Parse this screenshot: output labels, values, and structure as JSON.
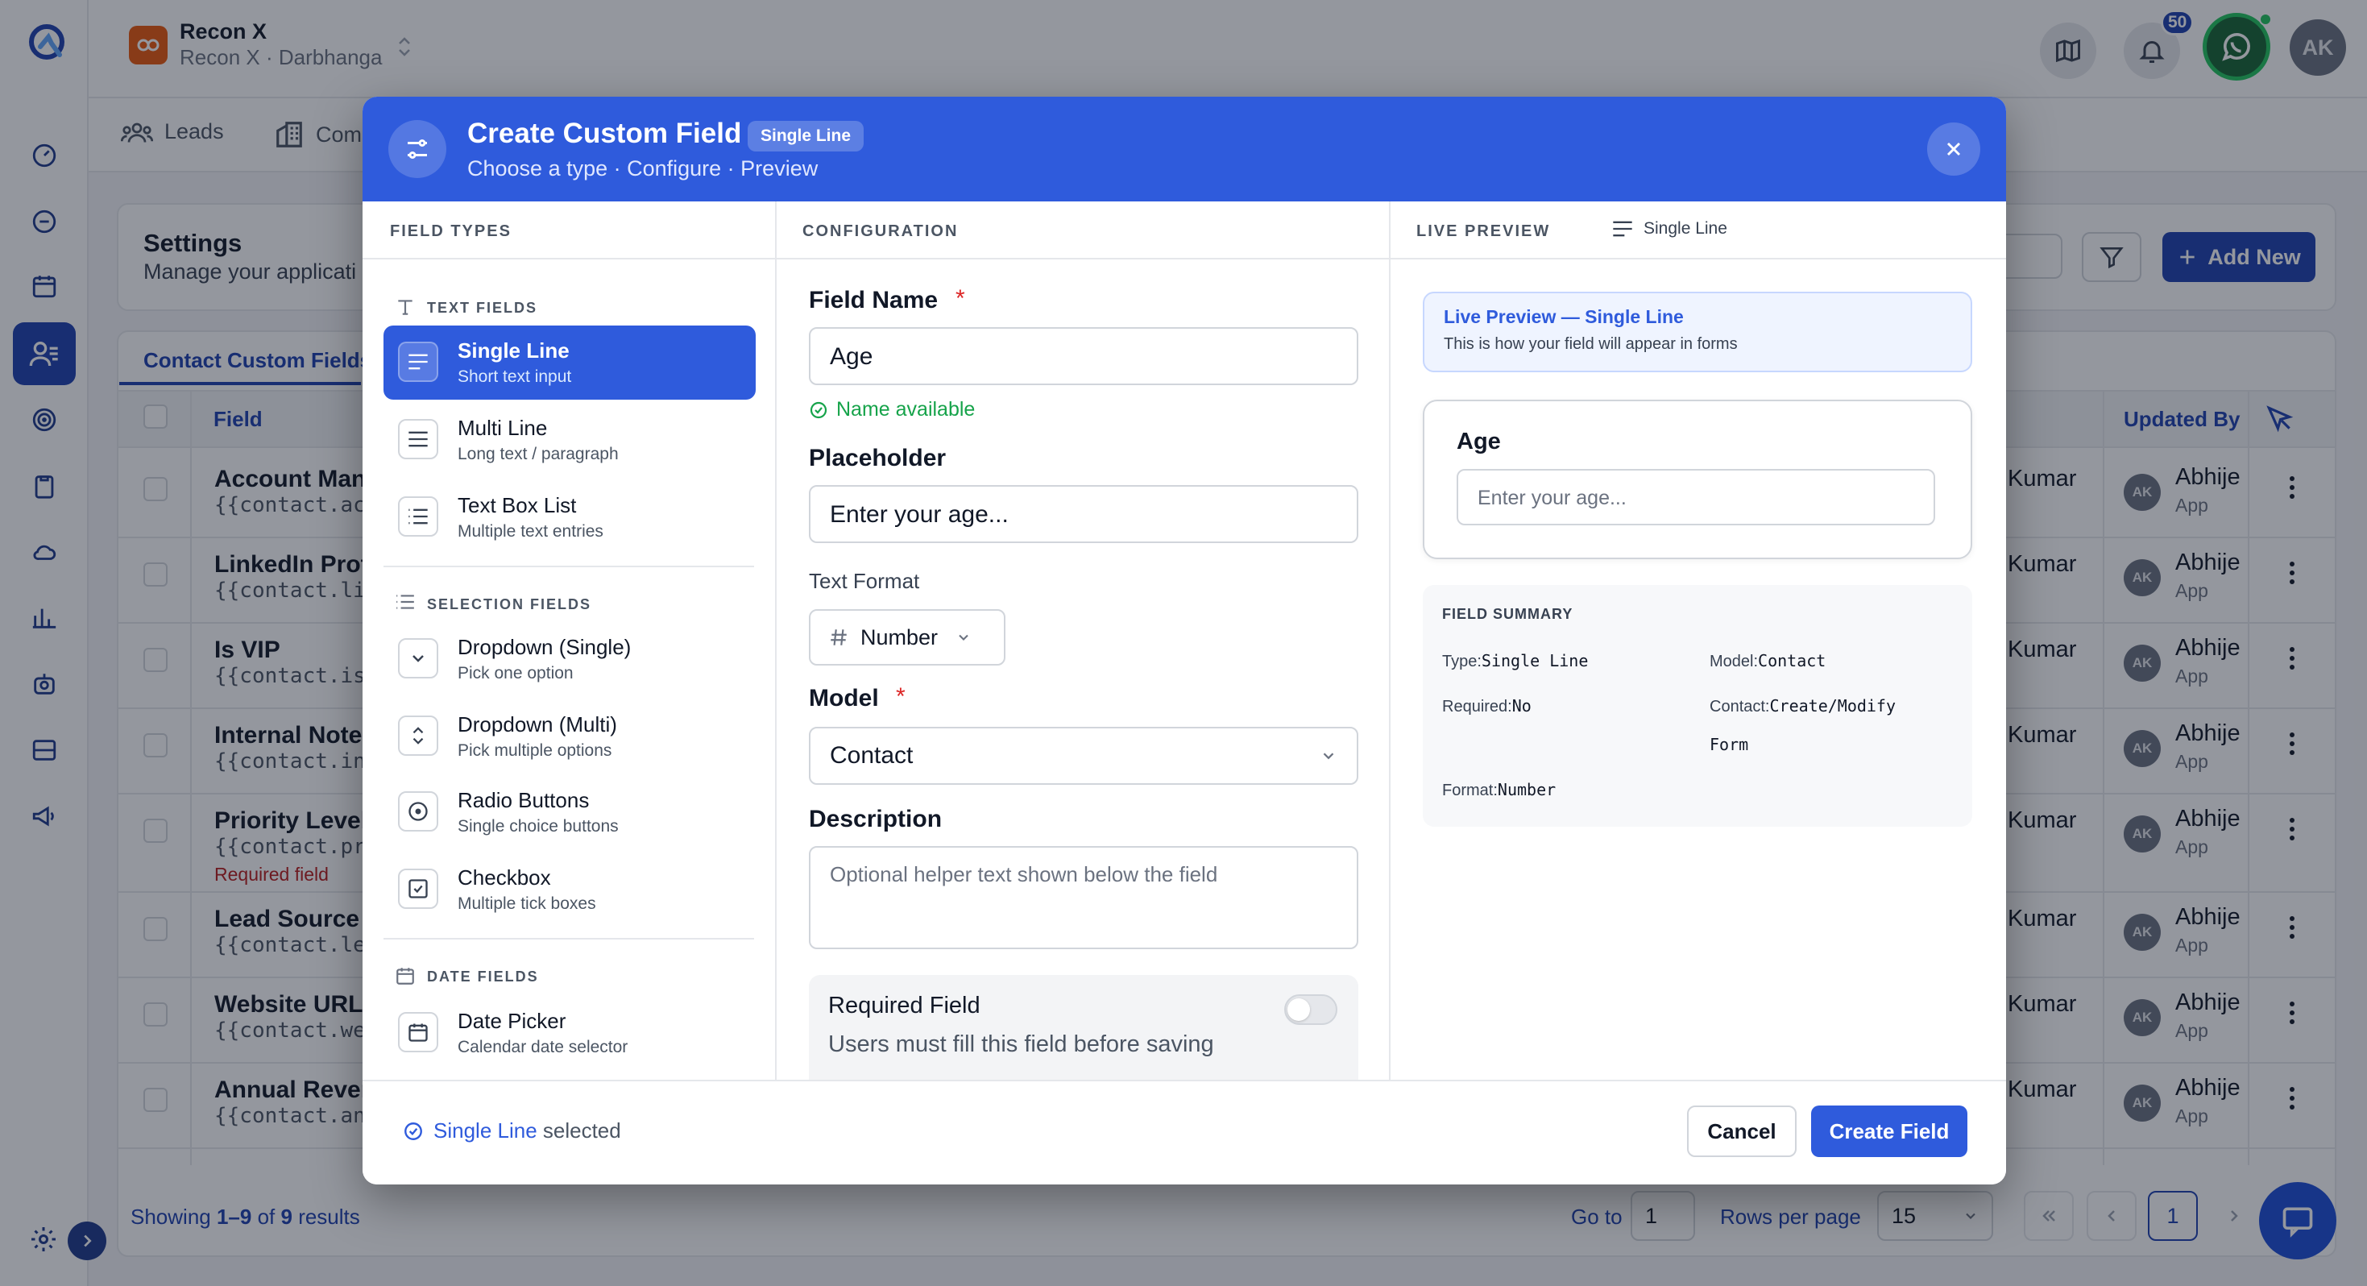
{
  "app": {
    "org_name": "Recon X",
    "org_subtitle": "Recon X · Darbhanga",
    "notification_count": "50",
    "user_initials": "AK"
  },
  "tabs": [
    {
      "label": "Leads"
    },
    {
      "label": "Com"
    }
  ],
  "settings": {
    "title": "Settings",
    "subtitle": "Manage your applicati",
    "add_new_label": "Add New",
    "active_tab": "Contact Custom Fields"
  },
  "table": {
    "headers": {
      "field": "Field",
      "updated_by": "Updated By"
    },
    "rows": [
      {
        "name": "Account Man",
        "key": "{{contact.acc",
        "required": "",
        "kumar": "Kumar",
        "initials": "AK",
        "updated_by": "Abhije",
        "updated_via": "App"
      },
      {
        "name": "LinkedIn Profi",
        "key": "{{contact.lin",
        "required": "",
        "kumar": "Kumar",
        "initials": "AK",
        "updated_by": "Abhije",
        "updated_via": "App"
      },
      {
        "name": "Is VIP",
        "key": "{{contact.is_",
        "required": "",
        "kumar": "Kumar",
        "initials": "AK",
        "updated_by": "Abhije",
        "updated_via": "App"
      },
      {
        "name": "Internal Note",
        "key": "{{contact.int",
        "required": "",
        "kumar": "Kumar",
        "initials": "AK",
        "updated_by": "Abhije",
        "updated_via": "App"
      },
      {
        "name": "Priority Level",
        "key": "{{contact.pri",
        "required": "Required field",
        "kumar": "Kumar",
        "initials": "AK",
        "updated_by": "Abhije",
        "updated_via": "App"
      },
      {
        "name": "Lead Source",
        "key": "{{contact.lea",
        "required": "",
        "kumar": "Kumar",
        "initials": "AK",
        "updated_by": "Abhije",
        "updated_via": "App"
      },
      {
        "name": "Website URL",
        "key": "{{contact.web",
        "required": "",
        "kumar": "Kumar",
        "initials": "AK",
        "updated_by": "Abhije",
        "updated_via": "App"
      },
      {
        "name": "Annual Rever",
        "key": "{{contact.ann",
        "required": "",
        "kumar": "Kumar",
        "initials": "AK",
        "updated_by": "Abhije",
        "updated_via": "App"
      }
    ]
  },
  "pagination": {
    "showing_prefix": "Showing ",
    "showing_range": "1–9",
    "showing_of": " of ",
    "showing_total": "9",
    "showing_suffix": " results",
    "goto_label": "Go to",
    "goto_value": "1",
    "rows_label": "Rows per page",
    "rows_value": "15",
    "current_page": "1"
  },
  "modal": {
    "title": "Create Custom Field",
    "type_badge": "Single Line",
    "subtitle": "Choose a type · Configure · Preview",
    "columns": {
      "field_types": "FIELD TYPES",
      "configuration": "CONFIGURATION",
      "live_preview": "LIVE PREVIEW"
    },
    "config_type_indicator": "Single Line",
    "groups": [
      {
        "label": "TEXT FIELDS"
      },
      {
        "label": "SELECTION FIELDS"
      },
      {
        "label": "DATE FIELDS"
      }
    ],
    "types": [
      {
        "label": "Single Line",
        "desc": "Short text input",
        "icon": "align-lines-icon",
        "selected": true
      },
      {
        "label": "Multi Line",
        "desc": "Long text / paragraph",
        "icon": "menu-lines-icon",
        "selected": false
      },
      {
        "label": "Text Box List",
        "desc": "Multiple text entries",
        "icon": "list-icon",
        "selected": false
      },
      {
        "label": "Dropdown (Single)",
        "desc": "Pick one option",
        "icon": "chevron-down-icon",
        "selected": false
      },
      {
        "label": "Dropdown (Multi)",
        "desc": "Pick multiple options",
        "icon": "chevron-updown-icon",
        "selected": false
      },
      {
        "label": "Radio Buttons",
        "desc": "Single choice buttons",
        "icon": "radio-icon",
        "selected": false
      },
      {
        "label": "Checkbox",
        "desc": "Multiple tick boxes",
        "icon": "checkbox-icon",
        "selected": false
      },
      {
        "label": "Date Picker",
        "desc": "Calendar date selector",
        "icon": "calendar-icon",
        "selected": false
      }
    ],
    "config": {
      "field_name_label": "Field Name",
      "field_name_value": "Age",
      "name_status": "Name available",
      "placeholder_label": "Placeholder",
      "placeholder_value": "Enter your age...",
      "text_format_label": "Text Format",
      "text_format_value": "Number",
      "model_label": "Model",
      "model_value": "Contact",
      "description_label": "Description",
      "description_placeholder": "Optional helper text shown below the field",
      "required_title": "Required Field",
      "required_sub": "Users must fill this field before saving",
      "required_on": false,
      "required_star": "*"
    },
    "preview": {
      "banner_title": "Live Preview — Single Line",
      "banner_sub": "This is how your field will appear in forms",
      "field_label": "Age",
      "field_placeholder": "Enter your age...",
      "summary_title": "FIELD SUMMARY",
      "summary": {
        "type_key": "Type:",
        "type_val": "Single Line",
        "model_key": "Model:",
        "model_val": "Contact",
        "required_key": "Required:",
        "required_val": "No",
        "contact_key": "Contact:",
        "contact_val_1": "Create/Modify",
        "contact_val_2": "Form",
        "format_key": "Format:",
        "format_val": "Number"
      }
    },
    "footer": {
      "selected_type": "Single Line",
      "selected_suffix": " selected",
      "cancel_label": "Cancel",
      "create_label": "Create Field"
    }
  },
  "colors": {
    "primary": "#2f5bdc",
    "navy": "#1e40af",
    "success": "#16a34a",
    "danger": "#dc2626"
  }
}
